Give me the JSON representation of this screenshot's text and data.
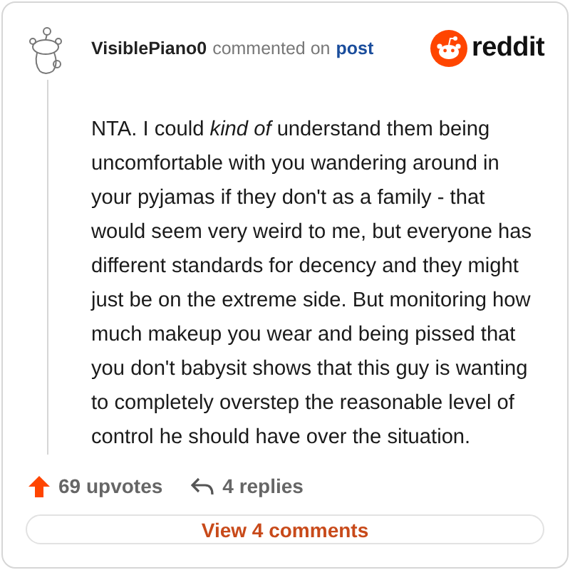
{
  "comment": {
    "username": "VisiblePiano0",
    "action": "commented on",
    "link": "post",
    "body": "NTA. I could *kind of* understand them being uncomfortable with you wandering around in your pyjamas if they don't as a family - that would seem very weird to me, but everyone has different standards for decency and they might just be on the extreme side. But monitoring how much makeup you wear and being pissed that you don't babysit shows that this guy is wanting to completely overstep the reasonable level of control he should have over the situation."
  },
  "logo": {
    "word": "reddit"
  },
  "footer": {
    "upvotes": "69 upvotes",
    "replies": "4 replies"
  },
  "button": {
    "label": "View 4 comments"
  }
}
